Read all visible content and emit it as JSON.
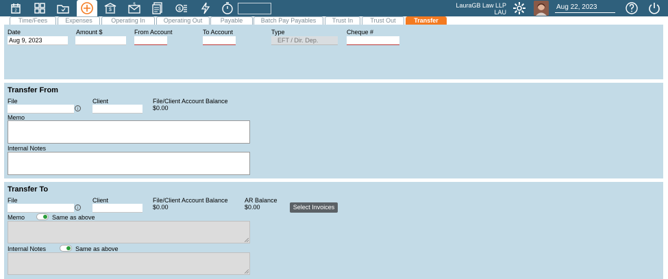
{
  "topbar": {
    "firm_name": "LauraGB Law LLP",
    "user_code": "LAU",
    "date": "Aug 22, 2023",
    "search_value": "",
    "icons": [
      "calendar-icon",
      "dashboard-icon",
      "folder-icon",
      "add-icon",
      "bank-icon",
      "money-transfer-icon",
      "documents-icon",
      "fees-icon",
      "lightning-icon",
      "timer-icon",
      "settings-icon",
      "help-icon",
      "power-icon"
    ]
  },
  "tabs": [
    {
      "label": "Time/Fees"
    },
    {
      "label": "Expenses"
    },
    {
      "label": "Operating In"
    },
    {
      "label": "Operating Out"
    },
    {
      "label": "Payable"
    },
    {
      "label": "Batch Pay Payables"
    },
    {
      "label": "Trust In"
    },
    {
      "label": "Trust Out"
    },
    {
      "label": "Transfer",
      "active": true
    }
  ],
  "header_form": {
    "date_label": "Date",
    "date_value": "Aug 9, 2023",
    "amount_label": "Amount $",
    "amount_value": "",
    "from_account_label": "From Account",
    "from_account_value": "",
    "to_account_label": "To Account",
    "to_account_value": "",
    "type_label": "Type",
    "type_value": "EFT / Dir. Dep.",
    "cheque_label": "Cheque #",
    "cheque_value": ""
  },
  "transfer_from": {
    "title": "Transfer From",
    "file_label": "File",
    "file_value": "",
    "client_label": "Client",
    "client_value": "",
    "balance_label": "File/Client Account Balance",
    "balance_value": "$0.00",
    "memo_label": "Memo",
    "memo_value": "",
    "notes_label": "Internal Notes",
    "notes_value": ""
  },
  "transfer_to": {
    "title": "Transfer To",
    "file_label": "File",
    "file_value": "",
    "client_label": "Client",
    "client_value": "",
    "balance_label": "File/Client Account Balance",
    "balance_value": "$0.00",
    "ar_label": "AR Balance",
    "ar_value": "$0.00",
    "select_invoices_label": "Select Invoices",
    "memo_label": "Memo",
    "memo_same_label": "Same as above",
    "memo_same_on": true,
    "notes_label": "Internal Notes",
    "notes_same_label": "Same as above",
    "notes_same_on": true
  },
  "info_icon_glyph": "i"
}
